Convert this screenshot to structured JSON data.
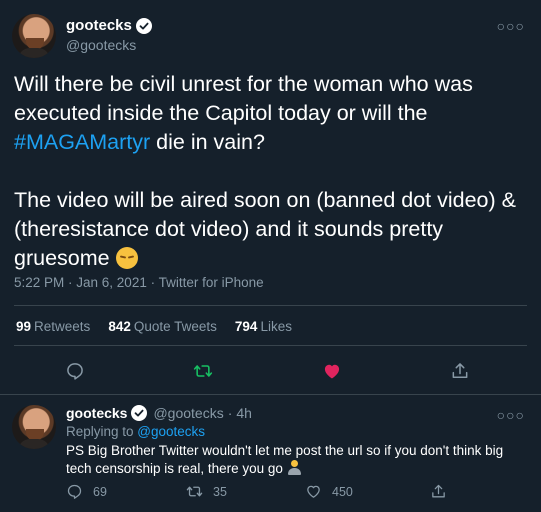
{
  "colors": {
    "background": "#15202b",
    "text": "#ffffff",
    "secondary": "#8899a6",
    "link": "#1da1f2",
    "retweet_green": "#17bf63",
    "like_red": "#e0245e",
    "divider": "#38444d"
  },
  "main_tweet": {
    "display_name": "gootecks",
    "handle": "@gootecks",
    "verified": true,
    "text": {
      "line1_before": "Will there be civil unrest for the woman who was executed inside the Capitol today or will the ",
      "hashtag": "#MAGAMartyr",
      "line1_after": " die in vain?",
      "paragraph2": "The video will be aired soon on (banned dot video) & (theresistance dot video)  and it sounds pretty gruesome ",
      "emoji": "pensive-face-emoji"
    },
    "meta": "5:22 PM · Jan 6, 2021 · Twitter for iPhone",
    "stats": {
      "retweets_count": "99",
      "retweets_label": "Retweets",
      "quotes_count": "842",
      "quotes_label": "Quote Tweets",
      "likes_count": "794",
      "likes_label": "Likes"
    },
    "actions": [
      "reply-icon",
      "retweet-icon",
      "like-icon",
      "share-icon"
    ]
  },
  "reply_tweet": {
    "display_name": "gootecks",
    "handle": "@gootecks",
    "verified": true,
    "time": "4h",
    "replying_label": "Replying to ",
    "replying_to": "@gootecks",
    "text": "PS Big Brother Twitter wouldn't let me post the url so if you don't think big tech censorship is real, there you go ",
    "emoji": "person-at-computer-emoji",
    "reply_count": "69",
    "retweet_count": "35",
    "like_count": "450"
  }
}
